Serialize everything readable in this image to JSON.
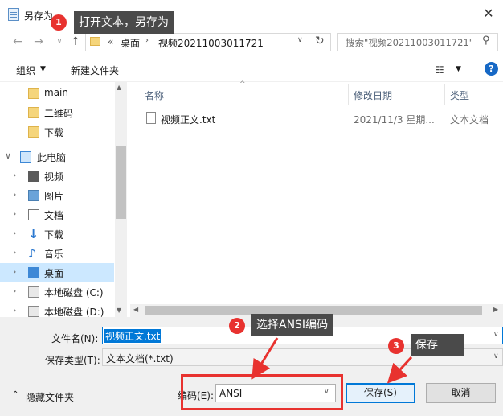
{
  "window": {
    "title": "另存为",
    "close_icon": "✕"
  },
  "address": {
    "overflow": "«",
    "crumbs": [
      "桌面",
      "视频20211003011721"
    ],
    "separator": "›",
    "search_placeholder": "搜索\"视频20211003011721\""
  },
  "toolbar": {
    "organize": "组织",
    "new_folder": "新建文件夹",
    "help": "?"
  },
  "nav": {
    "items": [
      {
        "label": "main",
        "icon": "folder-icon"
      },
      {
        "label": "二维码",
        "icon": "folder-icon"
      },
      {
        "label": "下载",
        "icon": "folder-icon"
      },
      {
        "label": "此电脑",
        "icon": "computer-icon"
      },
      {
        "label": "视频",
        "icon": "video-icon"
      },
      {
        "label": "图片",
        "icon": "picture-icon"
      },
      {
        "label": "文档",
        "icon": "document-icon"
      },
      {
        "label": "下载",
        "icon": "download-icon"
      },
      {
        "label": "音乐",
        "icon": "music-icon"
      },
      {
        "label": "桌面",
        "icon": "desktop-icon",
        "selected": true
      },
      {
        "label": "本地磁盘 (C:)",
        "icon": "drive-icon"
      },
      {
        "label": "本地磁盘 (D:)",
        "icon": "drive-icon"
      }
    ]
  },
  "columns": {
    "name": "名称",
    "date": "修改日期",
    "type": "类型"
  },
  "files": [
    {
      "name": "视频正文.txt",
      "date": "2021/11/3 星期...",
      "type": "文本文档"
    }
  ],
  "form": {
    "filename_label": "文件名(N):",
    "filename_value": "视频正文.txt",
    "filetype_label": "保存类型(T):",
    "filetype_value": "文本文档(*.txt)",
    "hide_folders": "隐藏文件夹",
    "encoding_label": "编码(E):",
    "encoding_value": "ANSI",
    "save": "保存(S)",
    "cancel": "取消"
  },
  "annotations": [
    {
      "number": "1",
      "text": "打开文本，另存为"
    },
    {
      "number": "2",
      "text": "选择ANSI编码"
    },
    {
      "number": "3",
      "text": "保存"
    }
  ],
  "colors": {
    "accent": "#0078d7",
    "annotation_red": "#e8322f",
    "callout_bg": "#4a4a4a"
  }
}
